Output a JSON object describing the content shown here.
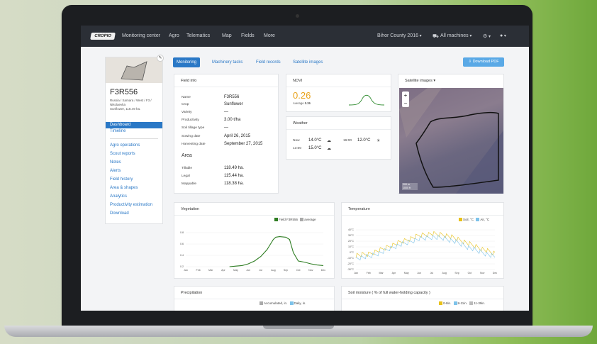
{
  "nav": {
    "logo": "CROPIO",
    "items": [
      "Monitoring center",
      "Agro",
      "Telematics",
      "Map",
      "Fields",
      "More"
    ],
    "season": "Bihor County 2016",
    "machines": "All machines",
    "settings_icon": "gear-icon",
    "user_icon": "user-icon"
  },
  "field": {
    "name": "F3R556",
    "location": "Russia / Samara / West / F3 / Nikolaevka",
    "summary": "Sunflower, 118.49 ha."
  },
  "sidebar": {
    "primary": [
      {
        "label": "Dashboard",
        "active": true
      },
      {
        "label": "Timeline",
        "active": false
      }
    ],
    "secondary": [
      "Agro operations",
      "Scout reports",
      "Notes",
      "Alerts",
      "Field history",
      "Area & shapes",
      "Analytics",
      "Productivity estimation",
      "Download"
    ]
  },
  "tabs": [
    {
      "label": "Monitoring",
      "active": true
    },
    {
      "label": "Machinery tasks",
      "active": false
    },
    {
      "label": "Field records",
      "active": false
    },
    {
      "label": "Satellite images",
      "active": false
    }
  ],
  "download_button": "Download PDF",
  "field_info": {
    "title": "Field info",
    "rows": [
      {
        "k": "Name",
        "v": "F3R556"
      },
      {
        "k": "Crop",
        "v": "Sunflower"
      },
      {
        "k": "Variety",
        "v": "—"
      },
      {
        "k": "Productivity",
        "v": "3.00 t/ha"
      },
      {
        "k": "Soil tillage type",
        "v": "—"
      },
      {
        "k": "Sowing date",
        "v": "April 26, 2015"
      },
      {
        "k": "Harvesting date",
        "v": "September 27, 2015"
      }
    ],
    "area_title": "Area",
    "area_rows": [
      {
        "k": "Tillable",
        "v": "118.49 ha."
      },
      {
        "k": "Legal",
        "v": "115.44 ha."
      },
      {
        "k": "Mappable",
        "v": "118.38 ha."
      }
    ]
  },
  "ndvi": {
    "title": "NDVI",
    "value": "0.26",
    "average_label": "Average",
    "average_value": "0.26",
    "color": "#e8a21a"
  },
  "weather": {
    "title": "Weather",
    "rows": [
      {
        "time": "Now",
        "temp": "14.0°C",
        "icon": "cloud-icon"
      },
      {
        "time": "13:00",
        "temp": "15.0°C",
        "icon": "cloud-icon"
      }
    ],
    "extra": {
      "time": "16:00",
      "temp": "12.0°C",
      "icon": "sun-icon"
    }
  },
  "satellite": {
    "title": "Satellite images",
    "zoom_in": "+",
    "zoom_out": "−",
    "scale": [
      "200 m",
      "1000 ft"
    ]
  },
  "vegetation": {
    "title": "Vegetation",
    "legend": [
      {
        "label": "Field F3R556",
        "color": "#2e7d22"
      },
      {
        "label": "average",
        "color": "#aaaaaa"
      }
    ]
  },
  "temperature": {
    "title": "Temperature",
    "legend": [
      {
        "label": "Soil, °C",
        "color": "#e8c11a"
      },
      {
        "label": "Air, °C",
        "color": "#7ec3ea"
      }
    ]
  },
  "precipitation": {
    "title": "Precipitation",
    "legend": [
      {
        "label": "Accumulated, in.",
        "color": "#aaaaaa"
      },
      {
        "label": "Daily, in.",
        "color": "#7ec3ea"
      }
    ]
  },
  "soil_moisture": {
    "title": "Soil moisture ( % of full water-holding capacity )",
    "legend": [
      {
        "label": "0-8in.",
        "color": "#e8c11a"
      },
      {
        "label": "8-11in.",
        "color": "#7ec3ea"
      },
      {
        "label": "11-39in.",
        "color": "#bbbbbb"
      }
    ]
  },
  "chart_data": [
    {
      "type": "line",
      "title": "Vegetation",
      "categories": [
        "Jan",
        "Feb",
        "Mar",
        "Apr",
        "May",
        "Jun",
        "Jul",
        "Aug",
        "Sep",
        "Oct",
        "Nov",
        "Dec"
      ],
      "y_ticks": [
        "0.8",
        "0.6",
        "0.4",
        "0.2"
      ],
      "ylim": [
        0.2,
        0.8
      ],
      "series": [
        {
          "name": "Field F3R556",
          "x": [
            3.5,
            4,
            4.5,
            5,
            5.5,
            6,
            6.5,
            7,
            7.2,
            7.5,
            8,
            8.3,
            8.6,
            9,
            9.5,
            10,
            10.5,
            11
          ],
          "values": [
            0.2,
            0.21,
            0.22,
            0.25,
            0.3,
            0.38,
            0.5,
            0.68,
            0.72,
            0.73,
            0.72,
            0.68,
            0.45,
            0.3,
            0.28,
            0.25,
            0.23,
            0.22
          ]
        }
      ]
    },
    {
      "type": "line",
      "title": "Temperature",
      "categories": [
        "Jan",
        "Feb",
        "Mar",
        "Apr",
        "May",
        "Jun",
        "Jul",
        "Aug",
        "Sep",
        "Oct",
        "Nov",
        "Dec"
      ],
      "y_ticks": [
        "40°C",
        "30°C",
        "20°C",
        "10°C",
        "0°C",
        "-10°C",
        "-20°C",
        "-30°C"
      ],
      "ylim": [
        -30,
        40
      ],
      "series": [
        {
          "name": "Soil, °C",
          "values": [
            -5,
            -3,
            5,
            14,
            22,
            30,
            33,
            31,
            24,
            15,
            6,
            -2
          ]
        },
        {
          "name": "Air, °C",
          "values": [
            -10,
            -7,
            0,
            10,
            17,
            24,
            27,
            25,
            18,
            8,
            0,
            -8
          ]
        }
      ]
    }
  ]
}
